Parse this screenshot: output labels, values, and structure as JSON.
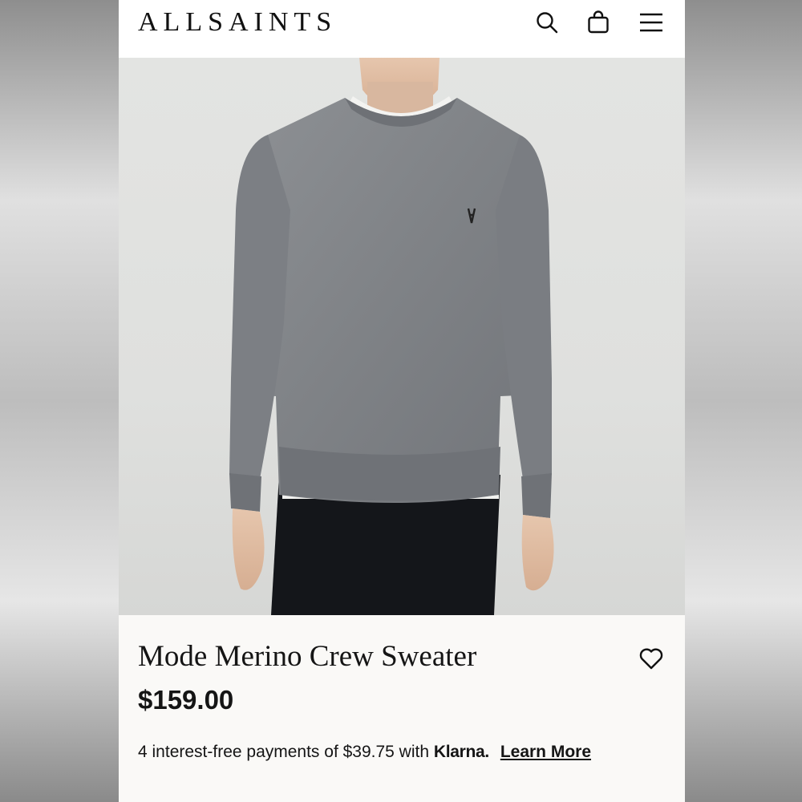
{
  "header": {
    "logo": "ALLSAINTS",
    "icons": [
      "search-icon",
      "shopping-bag-icon",
      "hamburger-menu-icon"
    ]
  },
  "product": {
    "image_alt": "Model wearing grey merino crew neck sweater",
    "title": "Mode Merino Crew Sweater",
    "price": "$159.00",
    "payment": {
      "text": "4 interest-free payments of $39.75 with",
      "provider": "Klarna.",
      "link_label": "Learn More"
    },
    "wishlist_icon": "heart-icon"
  },
  "colors": {
    "background": "#faf9f7",
    "text": "#151515",
    "sweater": "#808387"
  }
}
